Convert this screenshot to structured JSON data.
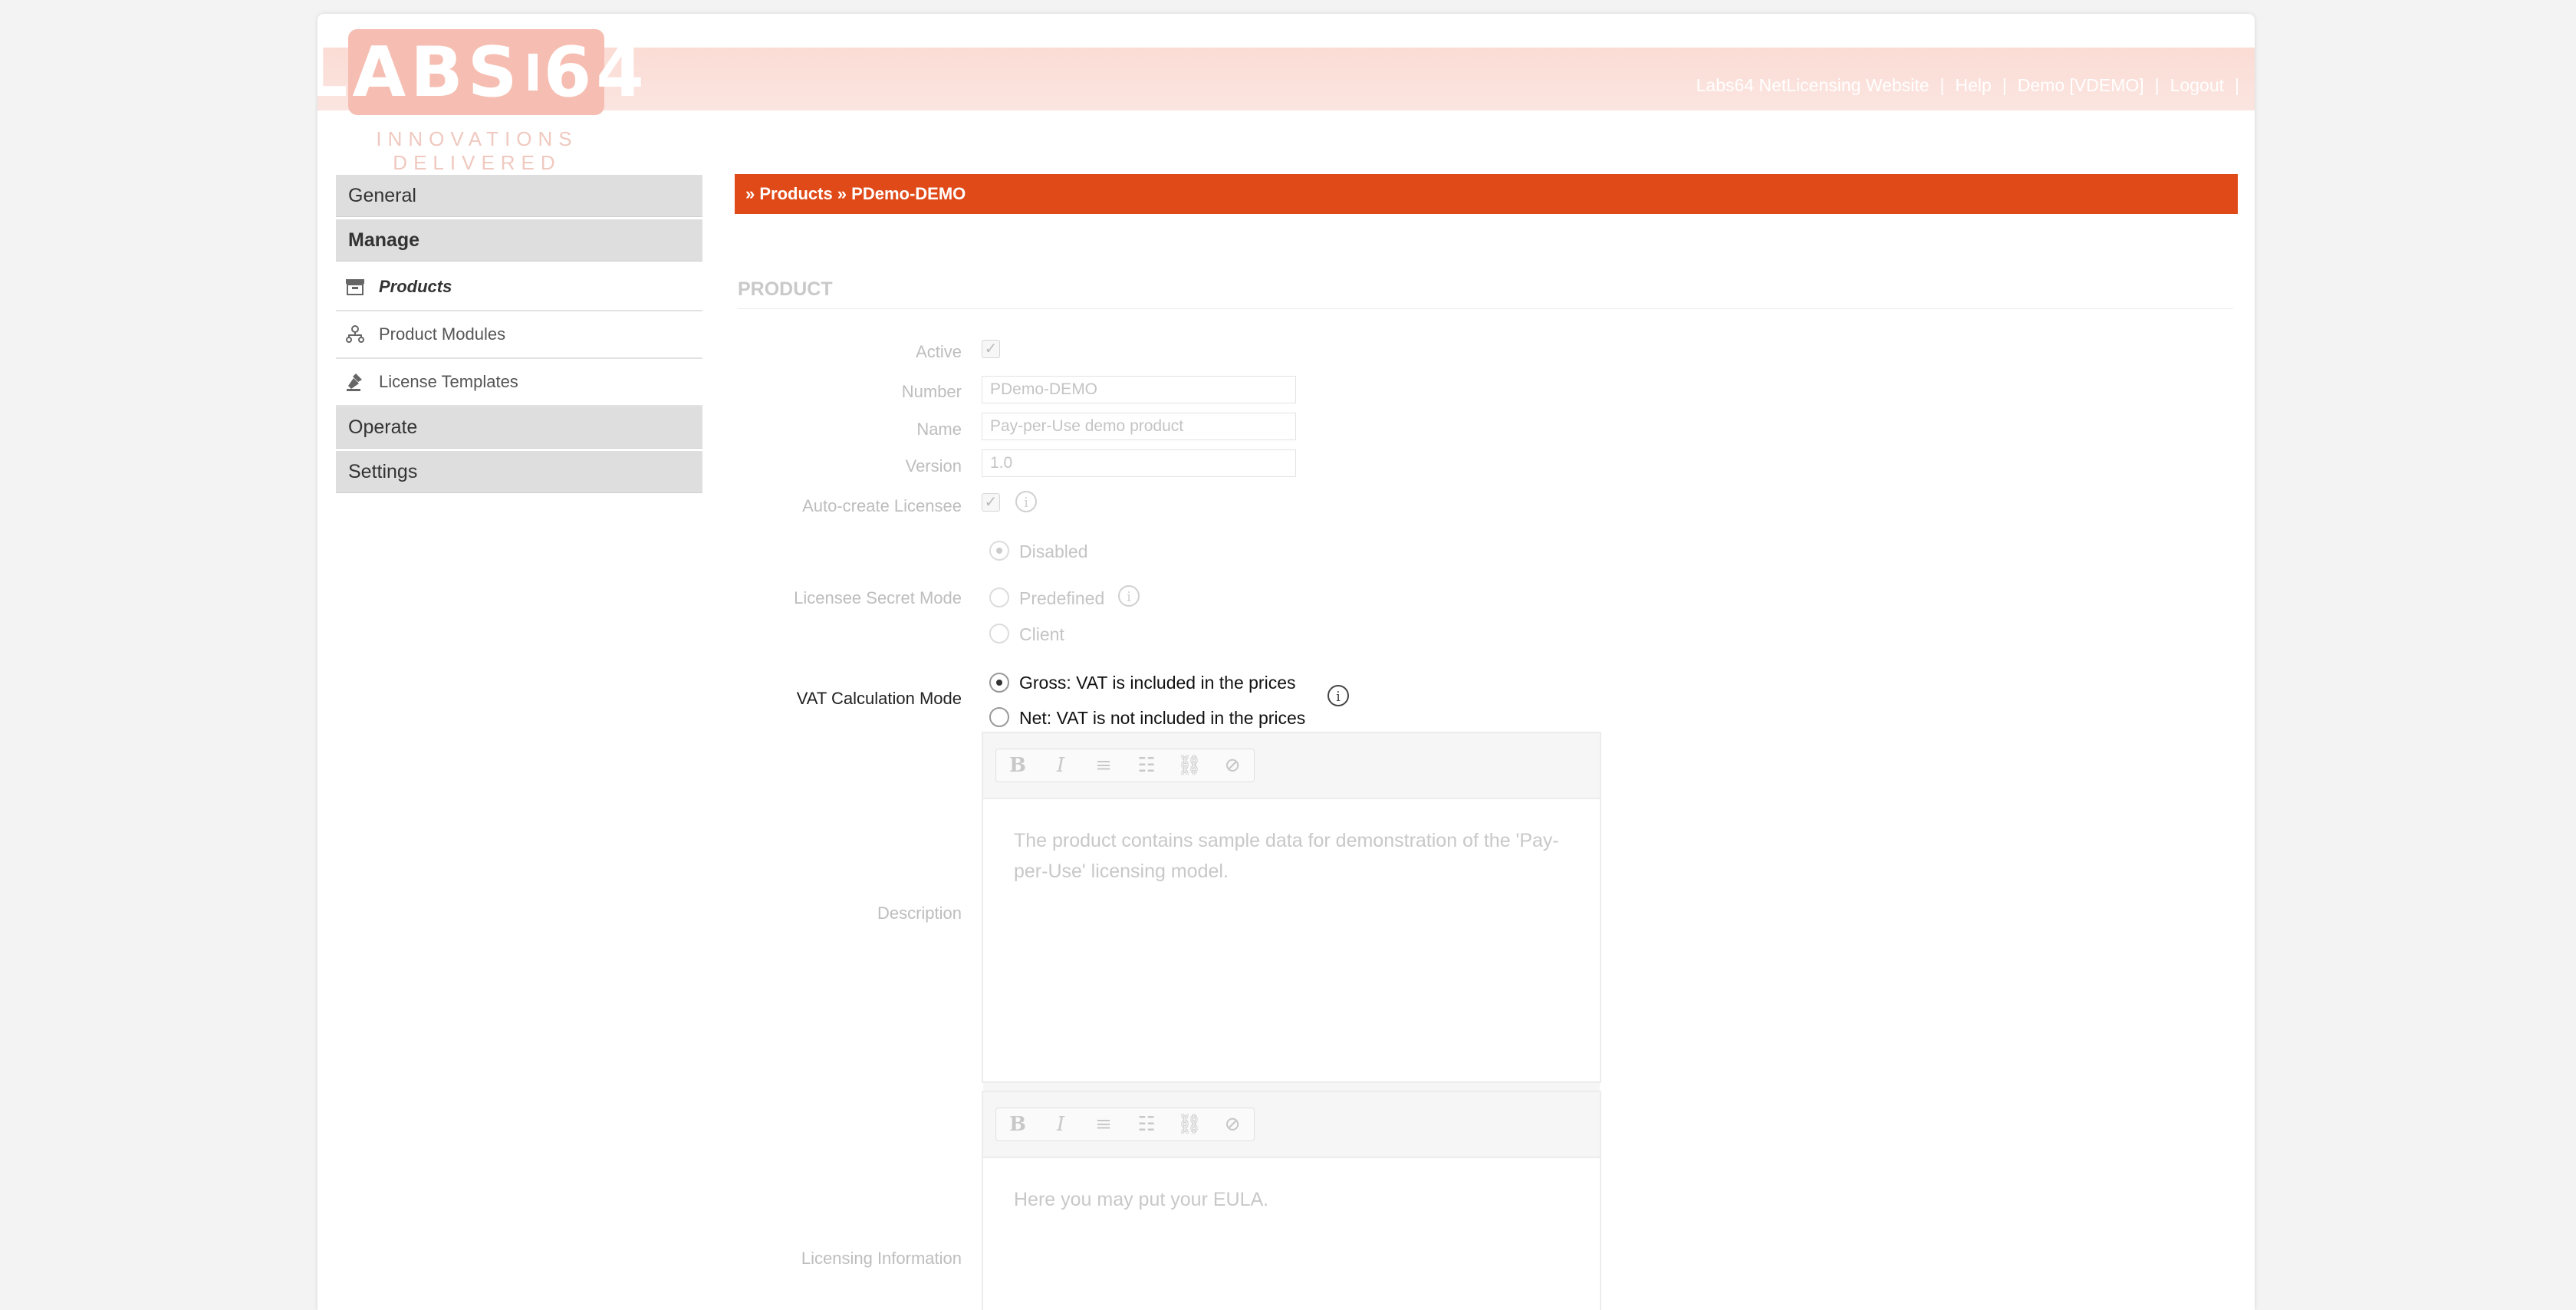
{
  "header": {
    "logo_text_left": "LABS",
    "logo_text_right": "64",
    "tagline": "INNOVATIONS DELIVERED",
    "nav": [
      {
        "label": "Labs64 NetLicensing Website"
      },
      {
        "label": "Help"
      },
      {
        "label": "Demo [VDEMO]"
      },
      {
        "label": "Logout"
      }
    ],
    "nav_sep": "|"
  },
  "sidebar": {
    "general": "General",
    "manage": "Manage",
    "items": [
      {
        "label": "Products",
        "icon": "box-icon"
      },
      {
        "label": "Product Modules",
        "icon": "sitemap-icon"
      },
      {
        "label": "License Templates",
        "icon": "stamp-icon"
      }
    ],
    "operate": "Operate",
    "settings": "Settings"
  },
  "breadcrumb": "» Products » PDemo-DEMO",
  "section_title": "PRODUCT",
  "form": {
    "active_label": "Active",
    "number_label": "Number",
    "number_value": "PDemo-DEMO",
    "name_label": "Name",
    "name_value": "Pay-per-Use demo product",
    "version_label": "Version",
    "version_value": "1.0",
    "auto_create_label": "Auto-create Licensee",
    "secret_mode_label": "Licensee Secret Mode",
    "secret_options": [
      "Disabled",
      "Predefined",
      "Client"
    ],
    "vat_label": "VAT Calculation Mode",
    "vat_options": [
      "Gross: VAT is included in the prices",
      "Net: VAT is not included in the prices"
    ],
    "description_label": "Description",
    "description_text": "The product contains sample data for demonstration of the 'Pay-per-Use' licensing model.",
    "licensing_info_label": "Licensing Information",
    "licensing_info_text": "Here you may put your EULA."
  },
  "colors": {
    "accent": "#e04a18",
    "logo": "#f6beb2"
  }
}
